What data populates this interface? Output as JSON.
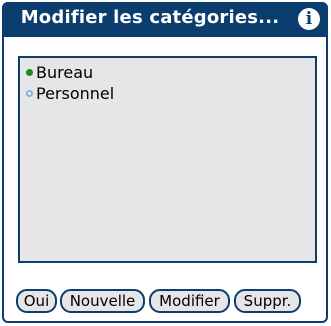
{
  "dialog": {
    "title": "Modifier les catégories...",
    "info_glyph": "i"
  },
  "categories": [
    {
      "label": "Bureau",
      "color": "#1a8a1a",
      "marker": "filled-dot"
    },
    {
      "label": "Personnel",
      "color": "#7fb2e6",
      "marker": "outlined-dot"
    }
  ],
  "buttons": {
    "ok": "Oui",
    "new": "Nouvelle",
    "modify": "Modifier",
    "delete": "Suppr."
  },
  "colors": {
    "accent": "#0b3d6e",
    "list_background": "#e6e6e6"
  }
}
